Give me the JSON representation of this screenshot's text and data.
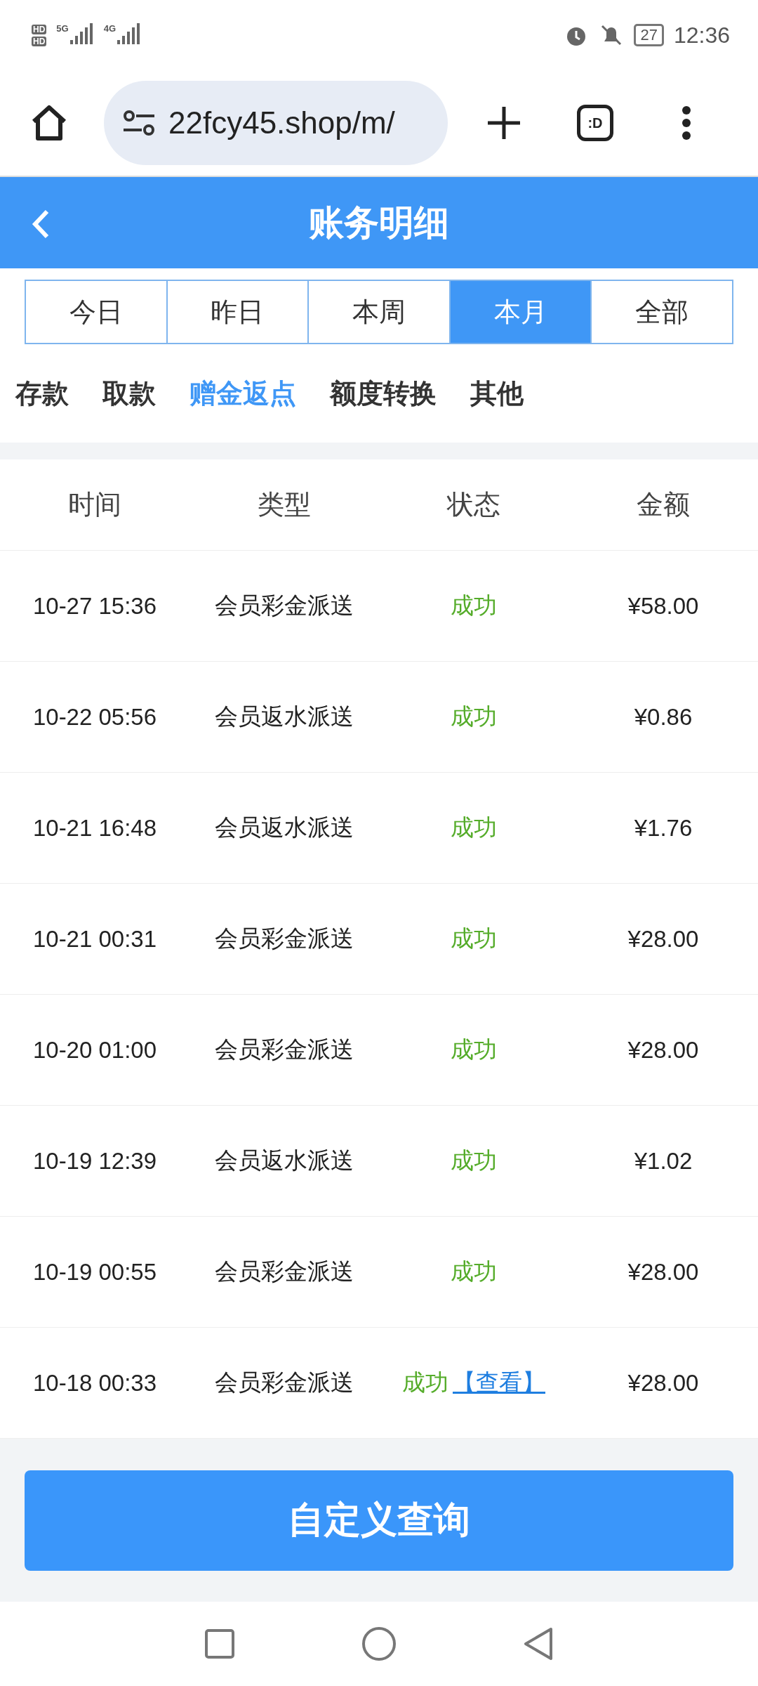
{
  "status_bar": {
    "sims": [
      "HD",
      "HD"
    ],
    "networks": [
      "5G",
      "4G"
    ],
    "battery": "27",
    "time": "12:36"
  },
  "browser": {
    "url": "22fcy45.shop/m/",
    "tab_badge": ":D"
  },
  "header": {
    "title": "账务明细"
  },
  "period_tabs": [
    {
      "label": "今日",
      "selected": false
    },
    {
      "label": "昨日",
      "selected": false
    },
    {
      "label": "本周",
      "selected": false
    },
    {
      "label": "本月",
      "selected": true
    },
    {
      "label": "全部",
      "selected": false
    }
  ],
  "category_tabs": [
    {
      "label": "存款",
      "selected": false
    },
    {
      "label": "取款",
      "selected": false
    },
    {
      "label": "赠金返点",
      "selected": true
    },
    {
      "label": "额度转换",
      "selected": false
    },
    {
      "label": "其他",
      "selected": false
    }
  ],
  "table": {
    "columns": [
      "时间",
      "类型",
      "状态",
      "金额"
    ],
    "rows": [
      {
        "time": "10-27 15:36",
        "type": "会员彩金派送",
        "status": "成功",
        "kind": "success",
        "amount": "¥58.00"
      },
      {
        "time": "10-22 05:56",
        "type": "会员返水派送",
        "status": "成功",
        "kind": "success",
        "amount": "¥0.86"
      },
      {
        "time": "10-21 16:48",
        "type": "会员返水派送",
        "status": "成功",
        "kind": "success",
        "amount": "¥1.76"
      },
      {
        "time": "10-21 00:31",
        "type": "会员彩金派送",
        "status": "成功",
        "kind": "success",
        "amount": "¥28.00"
      },
      {
        "time": "10-20 01:00",
        "type": "会员彩金派送",
        "status": "成功",
        "kind": "success",
        "amount": "¥28.00"
      },
      {
        "time": "10-19 12:39",
        "type": "会员返水派送",
        "status": "成功",
        "kind": "success",
        "amount": "¥1.02"
      },
      {
        "time": "10-19 00:55",
        "type": "会员彩金派送",
        "status": "成功",
        "kind": "success",
        "amount": "¥28.00"
      },
      {
        "time": "10-18 00:33",
        "type": "会员彩金派送",
        "status": "成功",
        "kind": "success",
        "link": "【查看】",
        "amount": "¥28.00"
      }
    ]
  },
  "query_button": "自定义查询"
}
